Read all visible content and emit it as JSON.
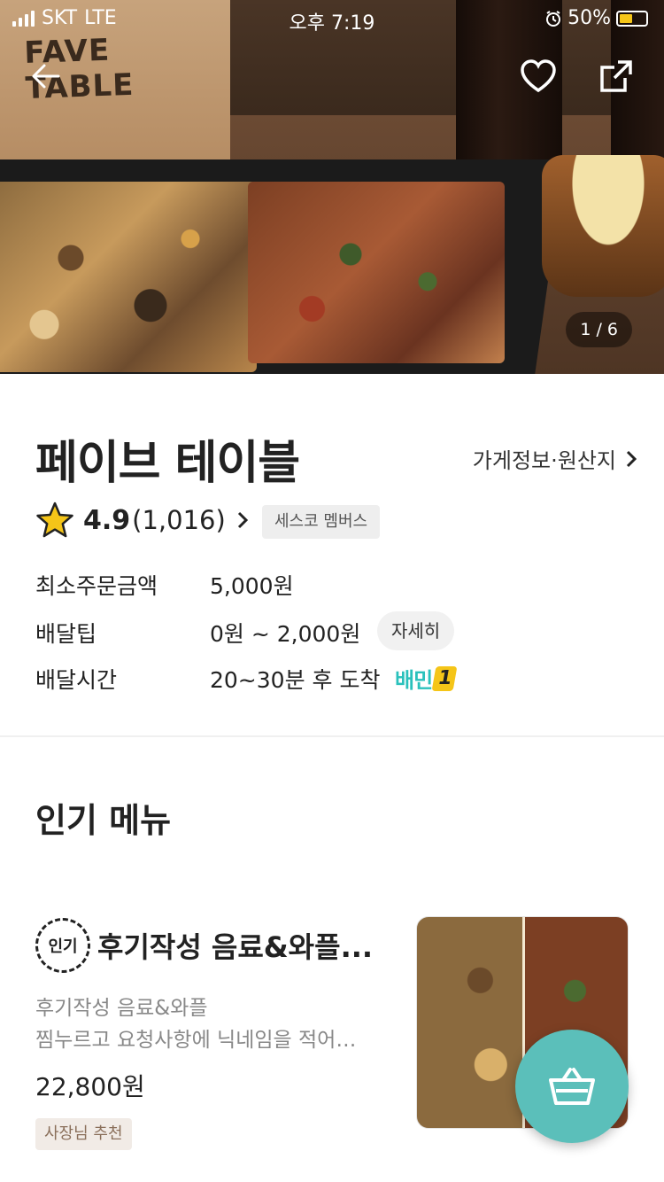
{
  "status_bar": {
    "carrier": "SKT",
    "network": "LTE",
    "time": "오후 7:19",
    "battery": "50%",
    "battery_level": 0.5
  },
  "hero": {
    "box_text": "FAVE TABLE",
    "page_indicator": "1 / 6"
  },
  "store": {
    "name": "페이브 테이블",
    "info_link": "가게정보·원산지",
    "rating": "4.9",
    "review_count": "(1,016)",
    "member_badge": "세스코 멤버스"
  },
  "info": {
    "min_order_label": "최소주문금액",
    "min_order_value": "5,000원",
    "delivery_tip_label": "배달팁",
    "delivery_tip_value": "0원 ~ 2,000원",
    "detail_button": "자세히",
    "delivery_time_label": "배달시간",
    "delivery_time_value": "20~30분 후 도착",
    "baemin_label": "배민",
    "baemin_number": "1"
  },
  "section": {
    "title": "인기 메뉴"
  },
  "menu_item": {
    "hot_badge": "인기",
    "name": "후기작성 음료&와플...",
    "desc_line1": "후기작성 음료&와플",
    "desc_line2": "찜누르고 요청사항에 닉네임을 적어…",
    "price": "22,800원",
    "badge": "사장님 추천"
  },
  "colors": {
    "accent": "#2ac1bc",
    "cart_button": "#5bbfba",
    "star": "#f5c518"
  }
}
